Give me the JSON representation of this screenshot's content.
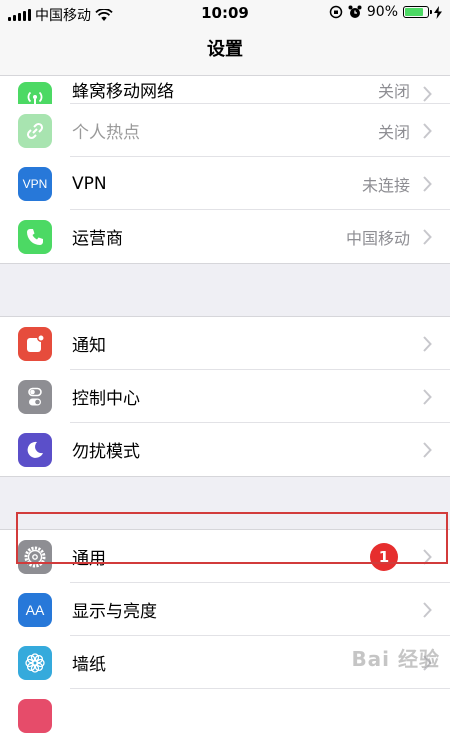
{
  "status_bar": {
    "carrier": "中国移动",
    "time": "10:09",
    "battery": "90%",
    "battery_level": 0.9
  },
  "nav": {
    "title": "设置"
  },
  "groups": [
    [
      {
        "label": "蜂窝移动网络",
        "value": "关闭",
        "icon": "cellular-antenna-icon",
        "color": "#4cd964"
      },
      {
        "label": "个人热点",
        "value": "关闭",
        "icon": "hotspot-chain-icon",
        "color": "#a8e4b0",
        "disabled": true
      },
      {
        "label": "VPN",
        "value": "未连接",
        "icon": "vpn-icon",
        "icon_text": "VPN",
        "color": "#2778d9"
      },
      {
        "label": "运营商",
        "value": "中国移动",
        "icon": "phone-icon",
        "color": "#4cd964"
      }
    ],
    [
      {
        "label": "通知",
        "value": "",
        "icon": "notification-icon",
        "color": "#e64c3c"
      },
      {
        "label": "控制中心",
        "value": "",
        "icon": "control-center-toggle-icon",
        "color": "#8e8e93"
      },
      {
        "label": "勿扰模式",
        "value": "",
        "icon": "moon-icon",
        "color": "#5b4fc9"
      }
    ],
    [
      {
        "label": "通用",
        "value": "",
        "icon": "gear-icon",
        "color": "#8e8e93",
        "badge": "1"
      },
      {
        "label": "显示与亮度",
        "value": "",
        "icon": "display-aa-icon",
        "icon_text": "AA",
        "color": "#2778d9"
      },
      {
        "label": "墙纸",
        "value": "",
        "icon": "wallpaper-flower-icon",
        "color": "#35aadc"
      }
    ]
  ],
  "watermark": "Bai 经验"
}
